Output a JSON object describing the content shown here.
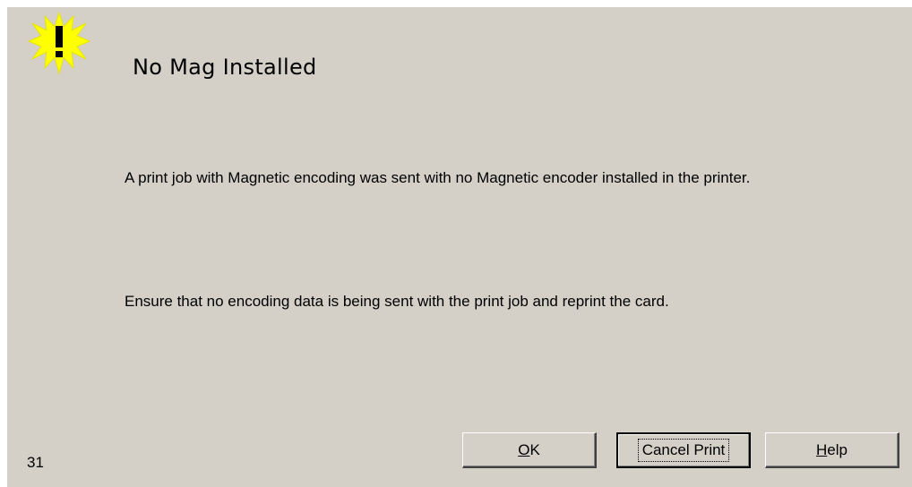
{
  "dialog": {
    "title": "No Mag Installed",
    "icon": "warning-exclamation-icon",
    "message_1": "A print job with Magnetic encoding was sent with no Magnetic encoder installed in the printer.",
    "message_2": "Ensure that no encoding data is being sent with the print job and reprint the card.",
    "error_code": "31"
  },
  "buttons": {
    "ok": {
      "mnemonic": "O",
      "rest": "K"
    },
    "cancel": "Cancel Print",
    "help": {
      "mnemonic": "H",
      "rest": "elp"
    }
  },
  "colors": {
    "dialog_bg": "#d4d0c8",
    "icon_yellow": "#ffff00"
  }
}
